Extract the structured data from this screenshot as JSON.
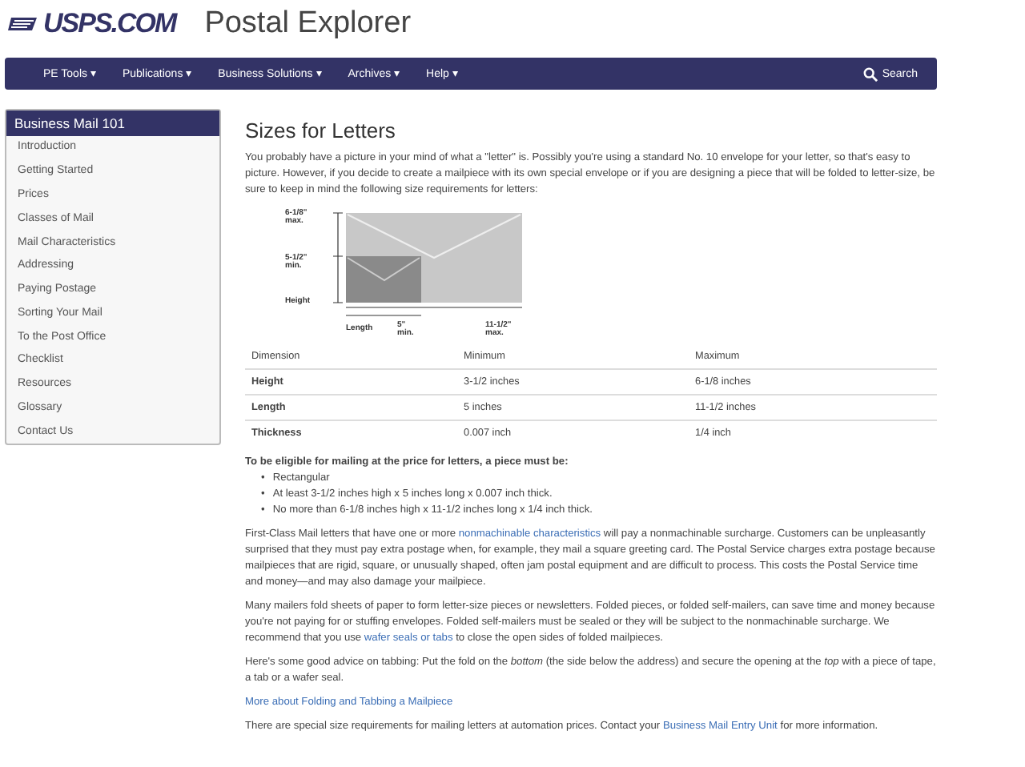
{
  "header": {
    "logo": "USPS.COM",
    "site_title": "Postal Explorer"
  },
  "nav": {
    "items": [
      {
        "label": "PE Tools",
        "caret": "▾"
      },
      {
        "label": "Publications",
        "caret": "▾"
      },
      {
        "label": "Business Solutions",
        "caret": "▾"
      },
      {
        "label": "Archives",
        "caret": "▾"
      },
      {
        "label": "Help",
        "caret": "▾"
      }
    ],
    "search": "Search"
  },
  "sidebar": {
    "title": "Business Mail 101",
    "items": [
      "Introduction",
      "Getting Started",
      "Prices",
      "Classes of Mail",
      "Mail Characteristics",
      "Addressing",
      "Paying Postage",
      "Sorting Your Mail",
      "To the Post Office",
      "Checklist",
      "Resources",
      "Glossary",
      "Contact Us"
    ]
  },
  "main": {
    "title": "Sizes for Letters",
    "intro": "You probably have a picture in your mind of what a \"letter\" is. Possibly you're using a standard No. 10 envelope for your letter, so that's easy to picture. However, if you decide to create a mailpiece with its own special envelope or if you are designing a piece that will be folded to letter-size, be sure to keep in mind the following size requirements for letters:",
    "diagram": {
      "max_height": [
        "6-1/8\"",
        "max."
      ],
      "min_height": [
        "5-1/2\"",
        "min."
      ],
      "height": "Height",
      "length": "Length",
      "min_length": [
        "5\"",
        "min."
      ],
      "max_length": [
        "11-1/2\"",
        "max."
      ]
    },
    "table": {
      "columns": [
        "Dimension",
        "Minimum",
        "Maximum"
      ],
      "rows": [
        [
          "Height",
          "3-1/2 inches",
          "6-1/8 inches"
        ],
        [
          "Length",
          "5 inches",
          "11-1/2 inches"
        ],
        [
          "Thickness",
          "0.007 inch",
          "1/4 inch"
        ]
      ]
    },
    "eligibility": {
      "heading": "To be eligible for mailing at the price for letters, a piece must be:",
      "bullet": "•",
      "items": [
        "Rectangular",
        "At least 3-1/2 inches high x 5 inches long x 0.007 inch thick.",
        "No more than 6-1/8 inches high x 11-1/2 inches long x 1/4 inch thick."
      ]
    },
    "paragraphs": [
      [
        {
          "kind": "text",
          "text": "First-Class Mail letters that have one or more "
        },
        {
          "kind": "link",
          "text": "nonmachinable characteristics"
        },
        {
          "kind": "text",
          "text": " will pay a nonmachinable surcharge. Customers can be unpleasantly surprised that they must pay extra postage when, for example, they mail a square greeting card. The Postal Service charges extra postage because mailpieces that are rigid, square, or unusually shaped, often jam postal equipment and are difficult to process. This costs the Postal Service time and money—and may also damage your mailpiece."
        }
      ],
      [
        {
          "kind": "text",
          "text": "Many mailers fold sheets of paper to form letter-size pieces or newsletters. Folded pieces, or folded self-mailers, can save time and money because you're not paying for or stuffing envelopes. Folded self-mailers must be sealed or they will be subject to the nonmachinable surcharge. We recommend that you use "
        },
        {
          "kind": "link",
          "text": "wafer seals or tabs"
        },
        {
          "kind": "text",
          "text": " to close the open sides of folded mailpieces."
        }
      ],
      [
        {
          "kind": "text",
          "text": "Here's some good advice on tabbing: Put the fold on the *bottom* (the side below the address) and secure the opening at the *top* with a piece of tape, a tab or a wafer seal."
        }
      ],
      [
        {
          "kind": "link",
          "text": "More about Folding and Tabbing a Mailpiece"
        }
      ],
      [
        {
          "kind": "text",
          "text": "There are special size requirements for mailing letters at automation prices. Contact your "
        },
        {
          "kind": "link",
          "text": "Business Mail Entry Unit"
        },
        {
          "kind": "text",
          "text": " for more information."
        }
      ]
    ]
  }
}
